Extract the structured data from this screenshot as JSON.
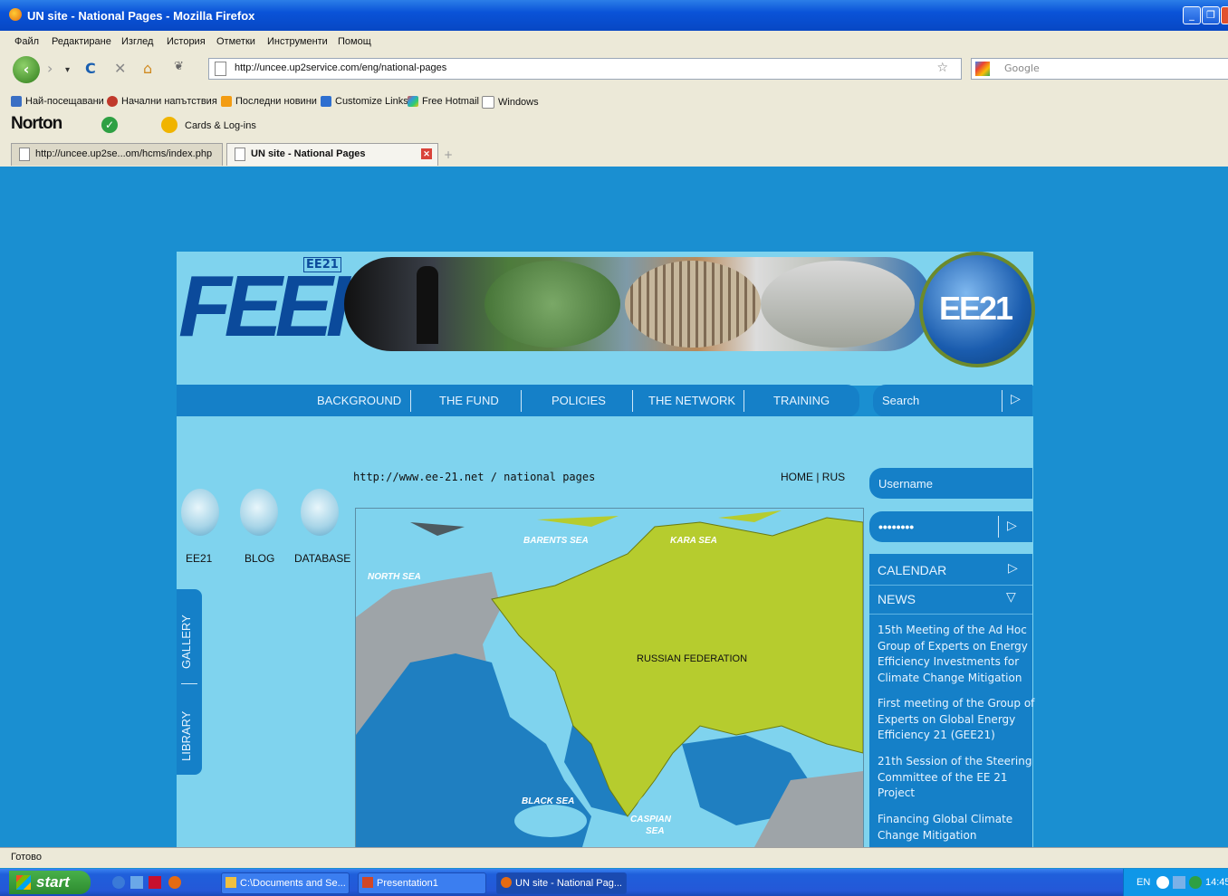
{
  "window": {
    "title": "UN site - National Pages - Mozilla Firefox"
  },
  "menu": [
    "Файл",
    "Редактиране",
    "Изглед",
    "История",
    "Отметки",
    "Инструменти",
    "Помощ"
  ],
  "url": "http://uncee.up2service.com/eng/national-pages",
  "search_engine_placeholder": "Google",
  "bookmarks": [
    "Най-посещавани",
    "Начални напътствия",
    "Последни новини",
    "Customize Links",
    "Free Hotmail",
    "Windows"
  ],
  "norton": {
    "label": "Norton",
    "cards": "Cards & Log-ins"
  },
  "tabs": [
    {
      "label": "http://uncee.up2se...om/hcms/index.php"
    },
    {
      "label": "UN site - National Pages"
    }
  ],
  "site": {
    "logo": "FEEI",
    "logo_badge": "EE21",
    "globe_text": "EE21",
    "nav": [
      "BACKGROUND",
      "THE FUND",
      "POLICIES",
      "THE NETWORK",
      "TRAINING"
    ],
    "search_label": "Search",
    "path": "http://www.ee-21.net / national pages",
    "home_link": "HOME",
    "rus_link": "RUS",
    "icons": [
      "EE21",
      "BLOG",
      "DATABASE"
    ],
    "side_tabs": [
      "GALLERY",
      "LIBRARY"
    ],
    "username_label": "Username",
    "password_mask": "••••••••",
    "calendar": "CALENDAR",
    "news": "NEWS",
    "news_items": [
      "15th Meeting of the Ad Hoc Group of Experts on Energy Efficiency Investments for Climate Change Mitigation",
      "First meeting of the Group of Experts on Global Energy Efficiency 21 (GEE21)",
      "21th Session of the Steering Committee of the EE 21 Project",
      "Financing Global Climate Change Mitigation"
    ],
    "map_labels": {
      "barents": "BARENTS SEA",
      "kara": "KARA SEA",
      "north": "NORTH SEA",
      "russia": "RUSSIAN FEDERATION",
      "black": "BLACK SEA",
      "caspian1": "CASPIAN",
      "caspian2": "SEA"
    }
  },
  "status": "Готово",
  "taskbar": {
    "start": "start",
    "tasks": [
      "C:\\Documents and Se...",
      "Presentation1",
      "UN site - National Pag..."
    ],
    "lang": "EN",
    "time": "14:45"
  }
}
